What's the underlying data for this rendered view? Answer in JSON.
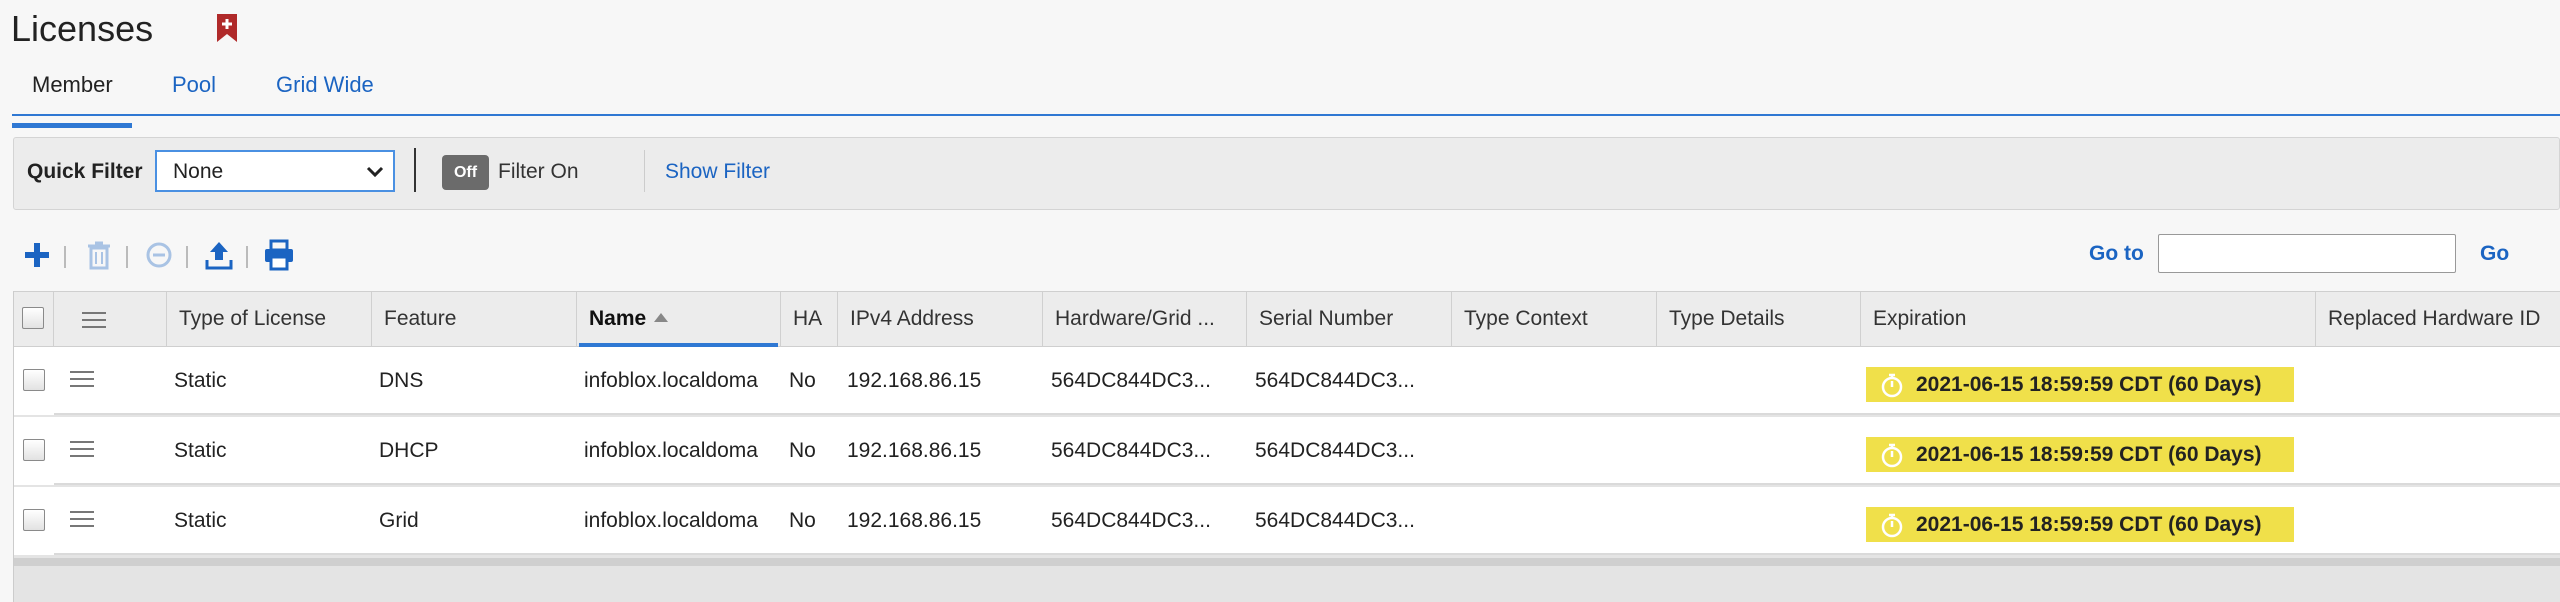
{
  "page": {
    "title": "Licenses"
  },
  "tabs": [
    {
      "label": "Member",
      "active": true
    },
    {
      "label": "Pool",
      "active": false
    },
    {
      "label": "Grid Wide",
      "active": false
    }
  ],
  "filter_bar": {
    "quick_filter_label": "Quick Filter",
    "quick_filter_value": "None",
    "toggle_label": "Off",
    "filter_on_label": "Filter On",
    "show_filter_label": "Show Filter"
  },
  "toolbar": {
    "icons": [
      "add-icon",
      "delete-icon",
      "remove-icon",
      "export-icon",
      "print-icon"
    ]
  },
  "goto": {
    "label": "Go to",
    "value": "",
    "button_label": "Go"
  },
  "table": {
    "columns": [
      "Type of License",
      "Feature",
      "Name",
      "HA",
      "IPv4 Address",
      "Hardware/Grid ...",
      "Serial Number",
      "Type Context",
      "Type Details",
      "Expiration",
      "Replaced Hardware ID"
    ],
    "sorted_column": "Name",
    "sort_direction": "ascending",
    "rows": [
      {
        "type": "Static",
        "feature": "DNS",
        "name": "infoblox.localdoma",
        "ha": "No",
        "ipv4": "192.168.86.15",
        "hardware": "564DC844DC3...",
        "serial": "564DC844DC3...",
        "type_context": "",
        "type_details": "",
        "expiration": "2021-06-15 18:59:59 CDT (60 Days)",
        "replaced_hw": ""
      },
      {
        "type": "Static",
        "feature": "DHCP",
        "name": "infoblox.localdoma",
        "ha": "No",
        "ipv4": "192.168.86.15",
        "hardware": "564DC844DC3...",
        "serial": "564DC844DC3...",
        "type_context": "",
        "type_details": "",
        "expiration": "2021-06-15 18:59:59 CDT (60 Days)",
        "replaced_hw": ""
      },
      {
        "type": "Static",
        "feature": "Grid",
        "name": "infoblox.localdoma",
        "ha": "No",
        "ipv4": "192.168.86.15",
        "hardware": "564DC844DC3...",
        "serial": "564DC844DC3...",
        "type_context": "",
        "type_details": "",
        "expiration": "2021-06-15 18:59:59 CDT (60 Days)",
        "replaced_hw": ""
      }
    ]
  },
  "colors": {
    "accent": "#2f78d3",
    "link": "#1b64c2",
    "bookmark": "#b02a2a",
    "expiration_badge": "#f0e04a"
  }
}
